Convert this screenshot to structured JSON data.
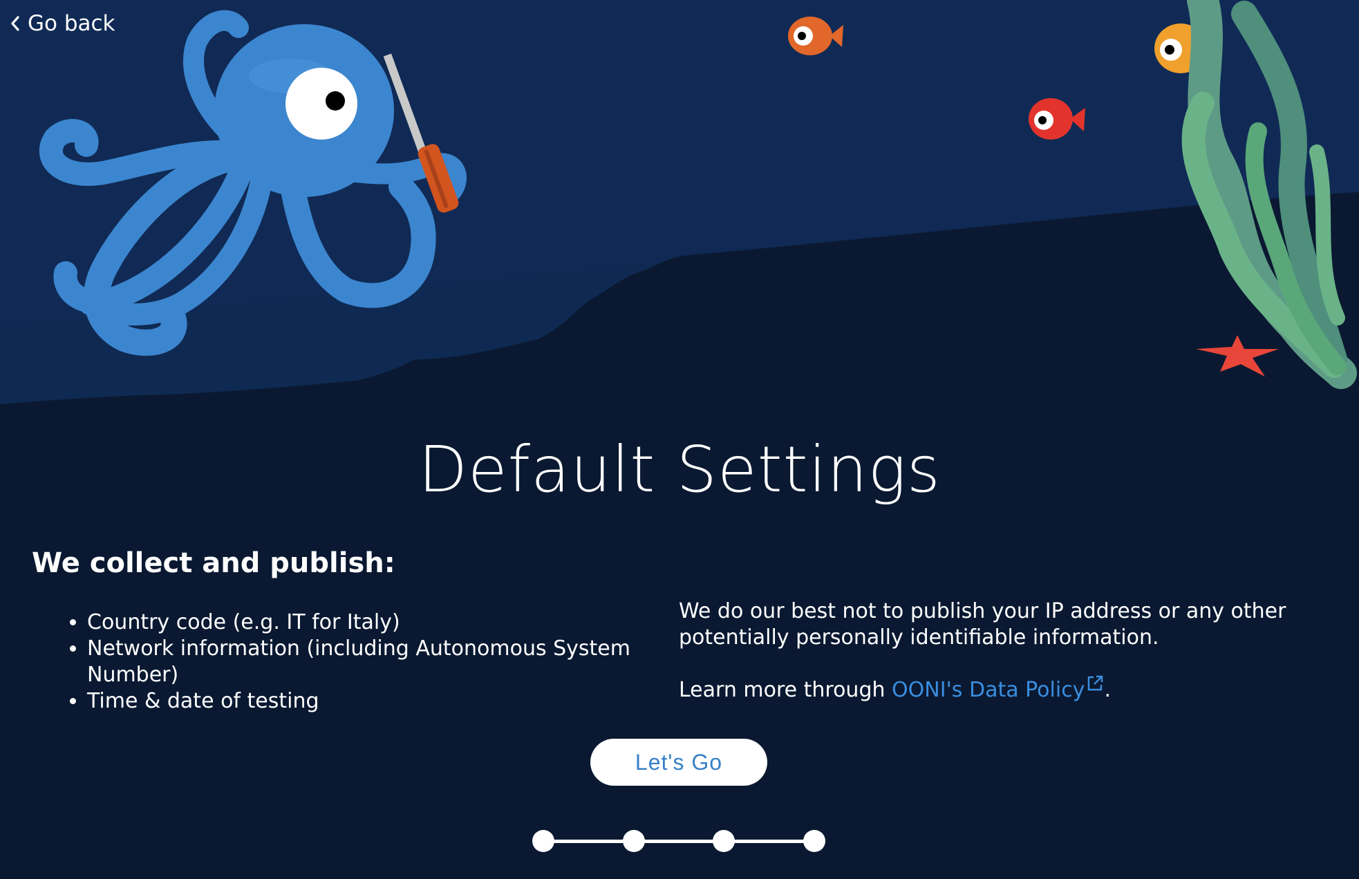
{
  "nav": {
    "back_label": "Go back"
  },
  "page": {
    "title": "Default Settings"
  },
  "collect": {
    "heading": "We collect and publish:",
    "items": [
      "Country code (e.g. IT for Italy)",
      "Network information (including Autonomous System Number)",
      "Time & date of testing"
    ]
  },
  "privacy": {
    "statement": "We do our best not to publish your IP address or any other potentially personally identifiable information.",
    "learn_more_prefix": "Learn more through ",
    "policy_link_label": "OONI's Data Policy",
    "learn_more_suffix": "."
  },
  "actions": {
    "primary_label": "Let's Go"
  },
  "progress": {
    "total_steps": 4,
    "current_step": 4
  },
  "colors": {
    "background": "#0a1931",
    "water": "#0f2a52",
    "accent_link": "#3a8ee0",
    "button_text": "#3780c8",
    "octopus": "#3c86cf"
  },
  "icons": {
    "back": "chevron-left-icon",
    "external_link": "external-link-icon"
  }
}
